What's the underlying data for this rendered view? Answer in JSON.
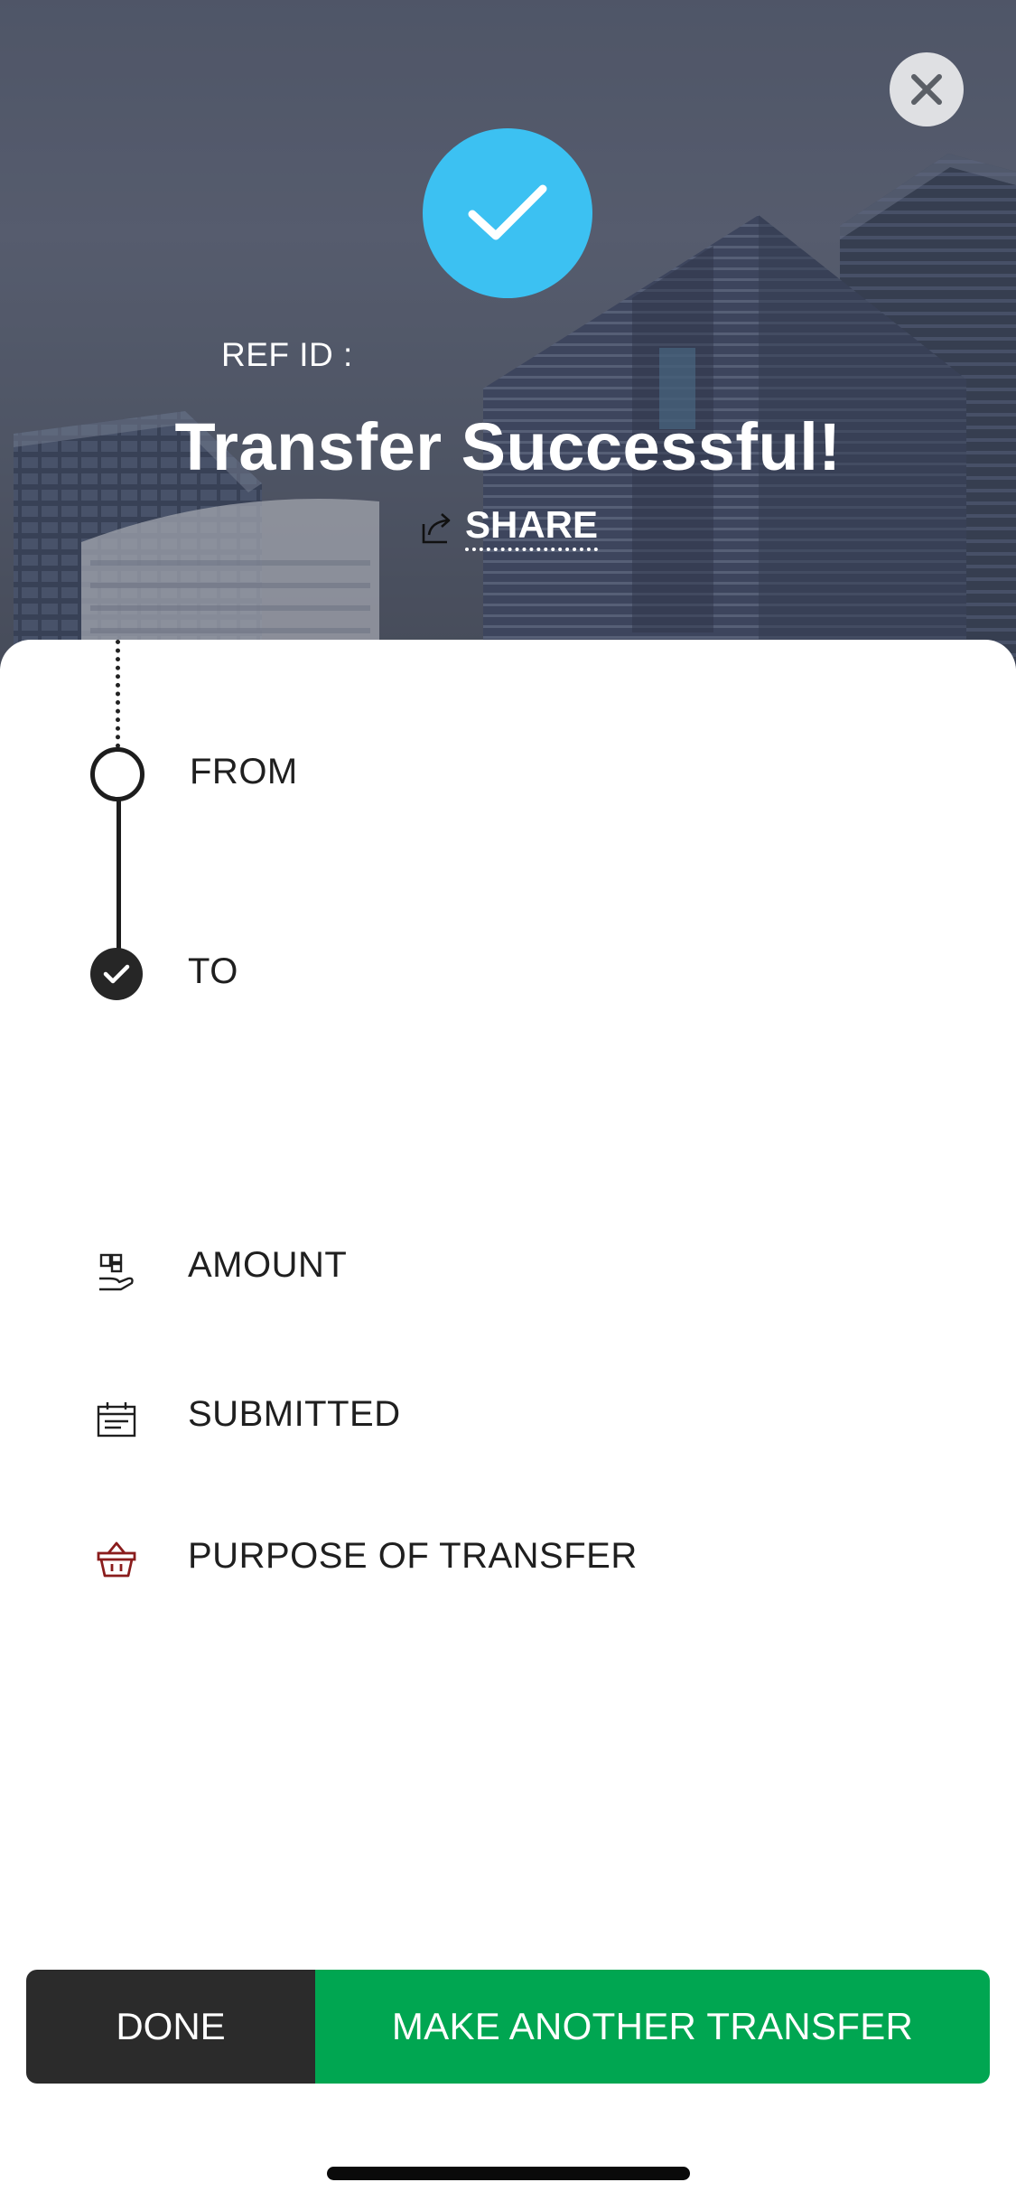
{
  "header": {
    "ref_id_label": "REF ID :",
    "title": "Transfer Successful!",
    "share_label": "SHARE",
    "close_icon": "close-icon",
    "success_icon": "checkmark-icon"
  },
  "details": {
    "from_label": "FROM",
    "to_label": "TO",
    "amount_label": "AMOUNT",
    "submitted_label": "SUBMITTED",
    "purpose_label": "PURPOSE OF TRANSFER"
  },
  "actions": {
    "done_label": "DONE",
    "another_label": "MAKE ANOTHER TRANSFER"
  },
  "colors": {
    "success_circle": "#3cc1f2",
    "primary_button": "#00a651",
    "secondary_button": "#2b2b2b",
    "basket_icon": "#8a1c1c"
  }
}
